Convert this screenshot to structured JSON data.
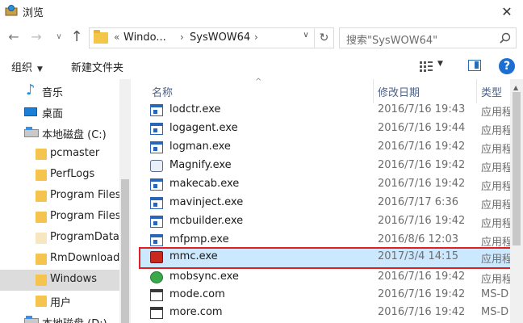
{
  "window": {
    "title": "浏览",
    "close_glyph": "✕"
  },
  "address": {
    "crumbs": [
      "Windo...",
      "SysWOW64"
    ],
    "prefix": "«",
    "separator": "›"
  },
  "search": {
    "placeholder": "搜索\"SysWOW64\""
  },
  "toolbar": {
    "organize_label": "组织",
    "new_folder_label": "新建文件夹",
    "help_glyph": "?"
  },
  "nav": {
    "items": [
      {
        "label": "音乐",
        "icon": "music-icon"
      },
      {
        "label": "桌面",
        "icon": "desktop-icon"
      },
      {
        "label": "本地磁盘 (C:)",
        "icon": "drive-icon"
      },
      {
        "label": "pcmaster",
        "icon": "folder-icon"
      },
      {
        "label": "PerfLogs",
        "icon": "folder-icon"
      },
      {
        "label": "Program Files",
        "icon": "folder-icon"
      },
      {
        "label": "Program Files",
        "icon": "folder-icon"
      },
      {
        "label": "ProgramData",
        "icon": "folder-icon"
      },
      {
        "label": "RmDownload",
        "icon": "folder-icon"
      },
      {
        "label": "Windows",
        "icon": "folder-icon",
        "selected": true
      },
      {
        "label": "用户",
        "icon": "folder-icon"
      },
      {
        "label": "本地磁盘 (D:)",
        "icon": "drive-icon"
      }
    ]
  },
  "files": {
    "columns": {
      "name": "名称",
      "date": "修改日期",
      "type": "类型"
    },
    "rows": [
      {
        "name": "lodctr.exe",
        "date": "2016/7/16 19:43",
        "type": "应用程",
        "icon": "exe-icon"
      },
      {
        "name": "logagent.exe",
        "date": "2016/7/16 19:44",
        "type": "应用程",
        "icon": "exe-icon"
      },
      {
        "name": "logman.exe",
        "date": "2016/7/16 19:42",
        "type": "应用程",
        "icon": "exe-icon"
      },
      {
        "name": "Magnify.exe",
        "date": "2016/7/16 19:42",
        "type": "应用程",
        "icon": "magnifier-icon"
      },
      {
        "name": "makecab.exe",
        "date": "2016/7/16 19:42",
        "type": "应用程",
        "icon": "exe-icon"
      },
      {
        "name": "mavinject.exe",
        "date": "2016/7/17 6:36",
        "type": "应用程",
        "icon": "exe-icon"
      },
      {
        "name": "mcbuilder.exe",
        "date": "2016/7/16 19:42",
        "type": "应用程",
        "icon": "exe-icon"
      },
      {
        "name": "mfpmp.exe",
        "date": "2016/8/6 12:03",
        "type": "应用程",
        "icon": "exe-icon"
      },
      {
        "name": "mmc.exe",
        "date": "2017/3/4 14:15",
        "type": "应用程",
        "icon": "mmc-icon",
        "selected": true
      },
      {
        "name": "mobsync.exe",
        "date": "2016/7/16 19:42",
        "type": "应用程",
        "icon": "sync-icon"
      },
      {
        "name": "mode.com",
        "date": "2016/7/16 19:42",
        "type": "MS-D",
        "icon": "com-icon"
      },
      {
        "name": "more.com",
        "date": "2016/7/16 19:42",
        "type": "MS-D",
        "icon": "com-icon"
      }
    ]
  },
  "colors": {
    "accent": "#1c6fd0",
    "selection": "#cce8ff",
    "highlight_border": "#e02020"
  }
}
